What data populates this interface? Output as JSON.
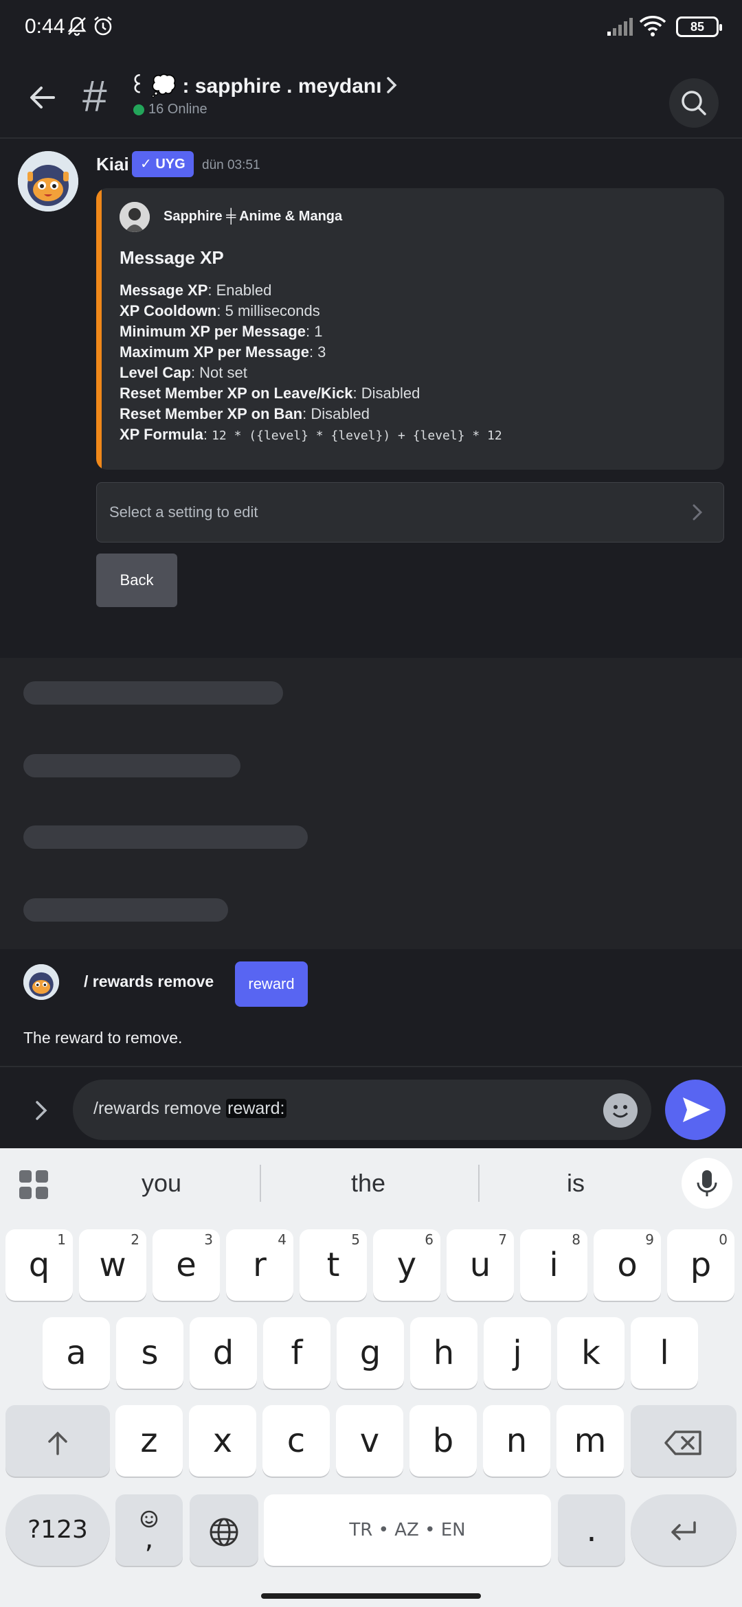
{
  "status_bar": {
    "time": "0:44",
    "battery": "85"
  },
  "header": {
    "channel_name": "꒰ 💭 : sapphire . meydanı",
    "online_count": "16 Online"
  },
  "message": {
    "author": "Kiai",
    "badge": "✓ UYG",
    "timestamp": "dün 03:51",
    "embed": {
      "accent_color": "#f0881a",
      "author": "Sapphire ╪ Anime & Manga",
      "title": "Message XP",
      "fields": [
        {
          "label": "Message XP",
          "value": ": Enabled"
        },
        {
          "label": "XP Cooldown",
          "value": ": 5 milliseconds"
        },
        {
          "label": "Minimum XP per Message",
          "value": ": 1"
        },
        {
          "label": "Maximum XP per Message",
          "value": ": 3"
        },
        {
          "label": "Level Cap",
          "value": ": Not set"
        },
        {
          "label": "Reset Member XP on Leave/Kick",
          "value": ": Disabled"
        },
        {
          "label": "Reset Member XP on Ban",
          "value": ": Disabled"
        }
      ],
      "formula_label": "XP Formula",
      "formula_sep": ": ",
      "formula_code": "12 * ({level} * {level}) + {level} * 12"
    },
    "select_placeholder": "Select a setting to edit",
    "back_button": "Back"
  },
  "command_suggestion": {
    "name": "/ rewards remove",
    "option_chip": "reward",
    "description": "The reward to remove."
  },
  "input": {
    "text_prefix": "/rewards remove ",
    "text_option": "reward:"
  },
  "keyboard": {
    "suggestions": [
      "you",
      "the",
      "is"
    ],
    "row1": [
      {
        "k": "q",
        "n": "1"
      },
      {
        "k": "w",
        "n": "2"
      },
      {
        "k": "e",
        "n": "3"
      },
      {
        "k": "r",
        "n": "4"
      },
      {
        "k": "t",
        "n": "5"
      },
      {
        "k": "y",
        "n": "6"
      },
      {
        "k": "u",
        "n": "7"
      },
      {
        "k": "i",
        "n": "8"
      },
      {
        "k": "o",
        "n": "9"
      },
      {
        "k": "p",
        "n": "0"
      }
    ],
    "row2": [
      "a",
      "s",
      "d",
      "f",
      "g",
      "h",
      "j",
      "k",
      "l"
    ],
    "row3": [
      "z",
      "x",
      "c",
      "v",
      "b",
      "n",
      "m"
    ],
    "symbols_key": "?123",
    "comma_key": ",",
    "space_label": "TR • AZ • EN",
    "period_key": "."
  },
  "colors": {
    "brand": "#5865f2",
    "online": "#23a55a",
    "background": "#1c1d22"
  }
}
